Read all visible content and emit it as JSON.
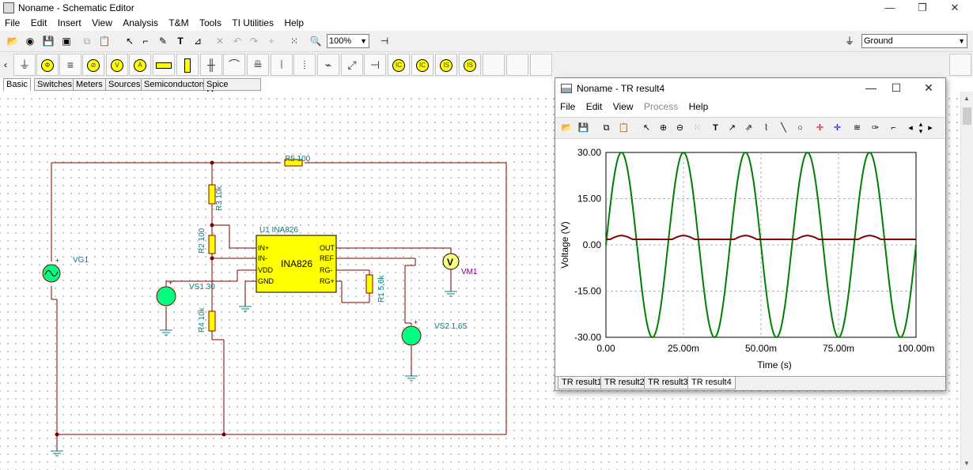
{
  "window": {
    "title": "Noname - Schematic Editor",
    "controls": {
      "minimize": "—",
      "maximize": "❐",
      "close": "✕"
    }
  },
  "menu": [
    "File",
    "Edit",
    "Insert",
    "View",
    "Analysis",
    "T&M",
    "Tools",
    "TI Utilities",
    "Help"
  ],
  "toolbar": {
    "zoom": "100%",
    "ground_select": "Ground"
  },
  "component_tabs": [
    "Basic",
    "Switches",
    "Meters",
    "Sources",
    "Semiconductors",
    "Spice Macros"
  ],
  "component_tabs_active": "Basic",
  "component_icons": [
    "ground-icon",
    "voltage-source-icon",
    "battery-icon",
    "current-meter-icon",
    "voltmeter-icon",
    "ammeter-icon",
    "resistor-icon",
    "capacitor-icon",
    "cap-icon",
    "inductor-icon",
    "transformer-icon",
    "switch-icon",
    "ic-icons"
  ],
  "schematic": {
    "labels": {
      "r5": "R5 100",
      "r3": "R3 10k",
      "r2": "R2 100",
      "r4": "R4 10k",
      "r1": "R1 5,6k",
      "u1": "U1 INA826",
      "ic_name": "INA826",
      "vg1": "VG1",
      "vs1": "VS1 30",
      "vs2": "VS2 1,65",
      "vm1": "VM1",
      "pin_inp": "IN+",
      "pin_inm": "IN-",
      "pin_vdd": "VDD",
      "pin_gnd": "GND",
      "pin_out": "OUT",
      "pin_ref": "REF",
      "pin_rgm": "RG-",
      "pin_rgp": "RG+",
      "vm_symbol": "V"
    },
    "colors": {
      "wire": "#800000",
      "label": "#008080",
      "ic_fill": "#ffff00",
      "vm_label": "#800080",
      "source_fill": "#00ff80"
    }
  },
  "result_window": {
    "title": "Noname - TR result4",
    "menu": [
      "File",
      "Edit",
      "View",
      "Process",
      "Help"
    ],
    "menu_disabled": [
      "Process"
    ],
    "tabs": [
      "TR result1",
      "TR result2",
      "TR result3",
      "TR result4"
    ],
    "active_tab": "TR result4"
  },
  "chart_data": {
    "type": "line",
    "xlabel": "Time (s)",
    "ylabel": "Voltage (V)",
    "xlim": [
      0,
      0.1
    ],
    "ylim": [
      -30,
      30
    ],
    "xticks": [
      "0.00",
      "25.00m",
      "50.00m",
      "75.00m",
      "100.00m"
    ],
    "xtick_values": [
      0,
      0.025,
      0.05,
      0.075,
      0.1
    ],
    "yticks": [
      "30.00",
      "15.00",
      "0.00",
      "-15.00",
      "-30.00"
    ],
    "ytick_values": [
      30,
      15,
      0,
      -15,
      -30
    ],
    "grid": true,
    "series": [
      {
        "color": "#008000",
        "kind": "sine",
        "amplitude": 30,
        "offset": 0,
        "frequency_hz": 50,
        "phase_start": 0
      },
      {
        "color": "#800000",
        "kind": "pulse",
        "baseline": 1.8,
        "peak": 3.0,
        "period_s": 0.02,
        "peak_at": 0.005
      }
    ]
  }
}
